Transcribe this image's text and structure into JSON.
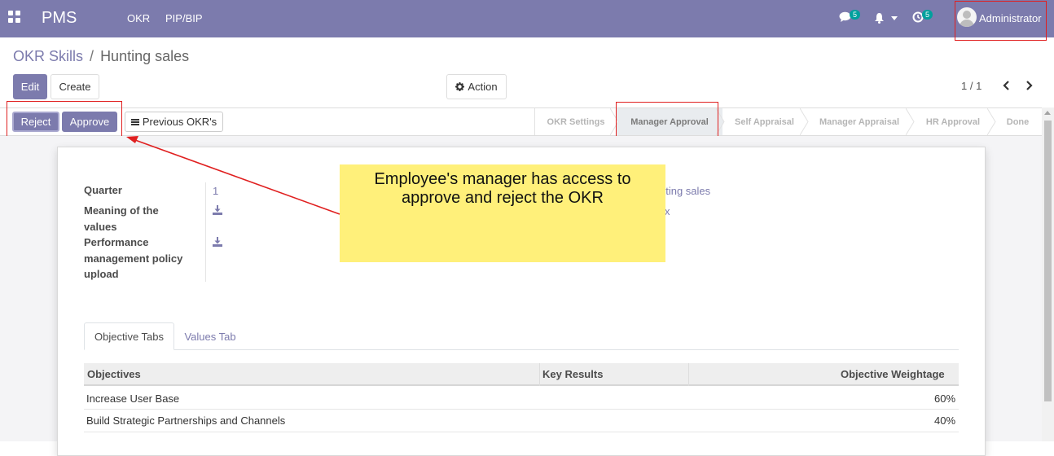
{
  "navbar": {
    "brand": "PMS",
    "menu": [
      "OKR",
      "PIP/BIP"
    ],
    "messages_badge": "5",
    "activities_badge": "5",
    "user": "Administrator"
  },
  "breadcrumb": {
    "parent": "OKR Skills",
    "separator": "/",
    "current": "Hunting sales"
  },
  "buttons": {
    "edit": "Edit",
    "create": "Create",
    "action": "Action"
  },
  "pager": {
    "value": "1 / 1"
  },
  "statusbar": {
    "reject": "Reject",
    "approve": "Approve",
    "previous": "Previous OKR's",
    "stages": [
      "OKR Settings",
      "Manager Approval",
      "Self Appraisal",
      "Manager Appraisal",
      "HR Approval",
      "Done"
    ],
    "active_stage": "Manager Approval"
  },
  "form": {
    "quarter_label": "Quarter",
    "quarter_value": "1",
    "meaning_label_1": "Meaning of the",
    "meaning_label_2": "values",
    "policy_label_1": "Performance",
    "policy_label_2": "management policy",
    "policy_label_3": "upload",
    "right_value_1": "nting sales",
    "right_value_2": "x"
  },
  "tabs": [
    "Objective Tabs",
    "Values Tab"
  ],
  "table": {
    "headers": [
      "Objectives",
      "Key Results",
      "Objective Weightage"
    ],
    "rows": [
      {
        "objective": "Increase User Base",
        "key_results": "",
        "weightage": "60%"
      },
      {
        "objective": "Build Strategic Partnerships and Channels",
        "key_results": "",
        "weightage": "40%"
      }
    ]
  },
  "callout": {
    "line1": "Employee's manager has access to",
    "line2": "approve and reject the OKR"
  },
  "colors": {
    "brand": "#7c7bad",
    "annotation_red": "#e02020",
    "callout_yellow": "#fff07a"
  }
}
